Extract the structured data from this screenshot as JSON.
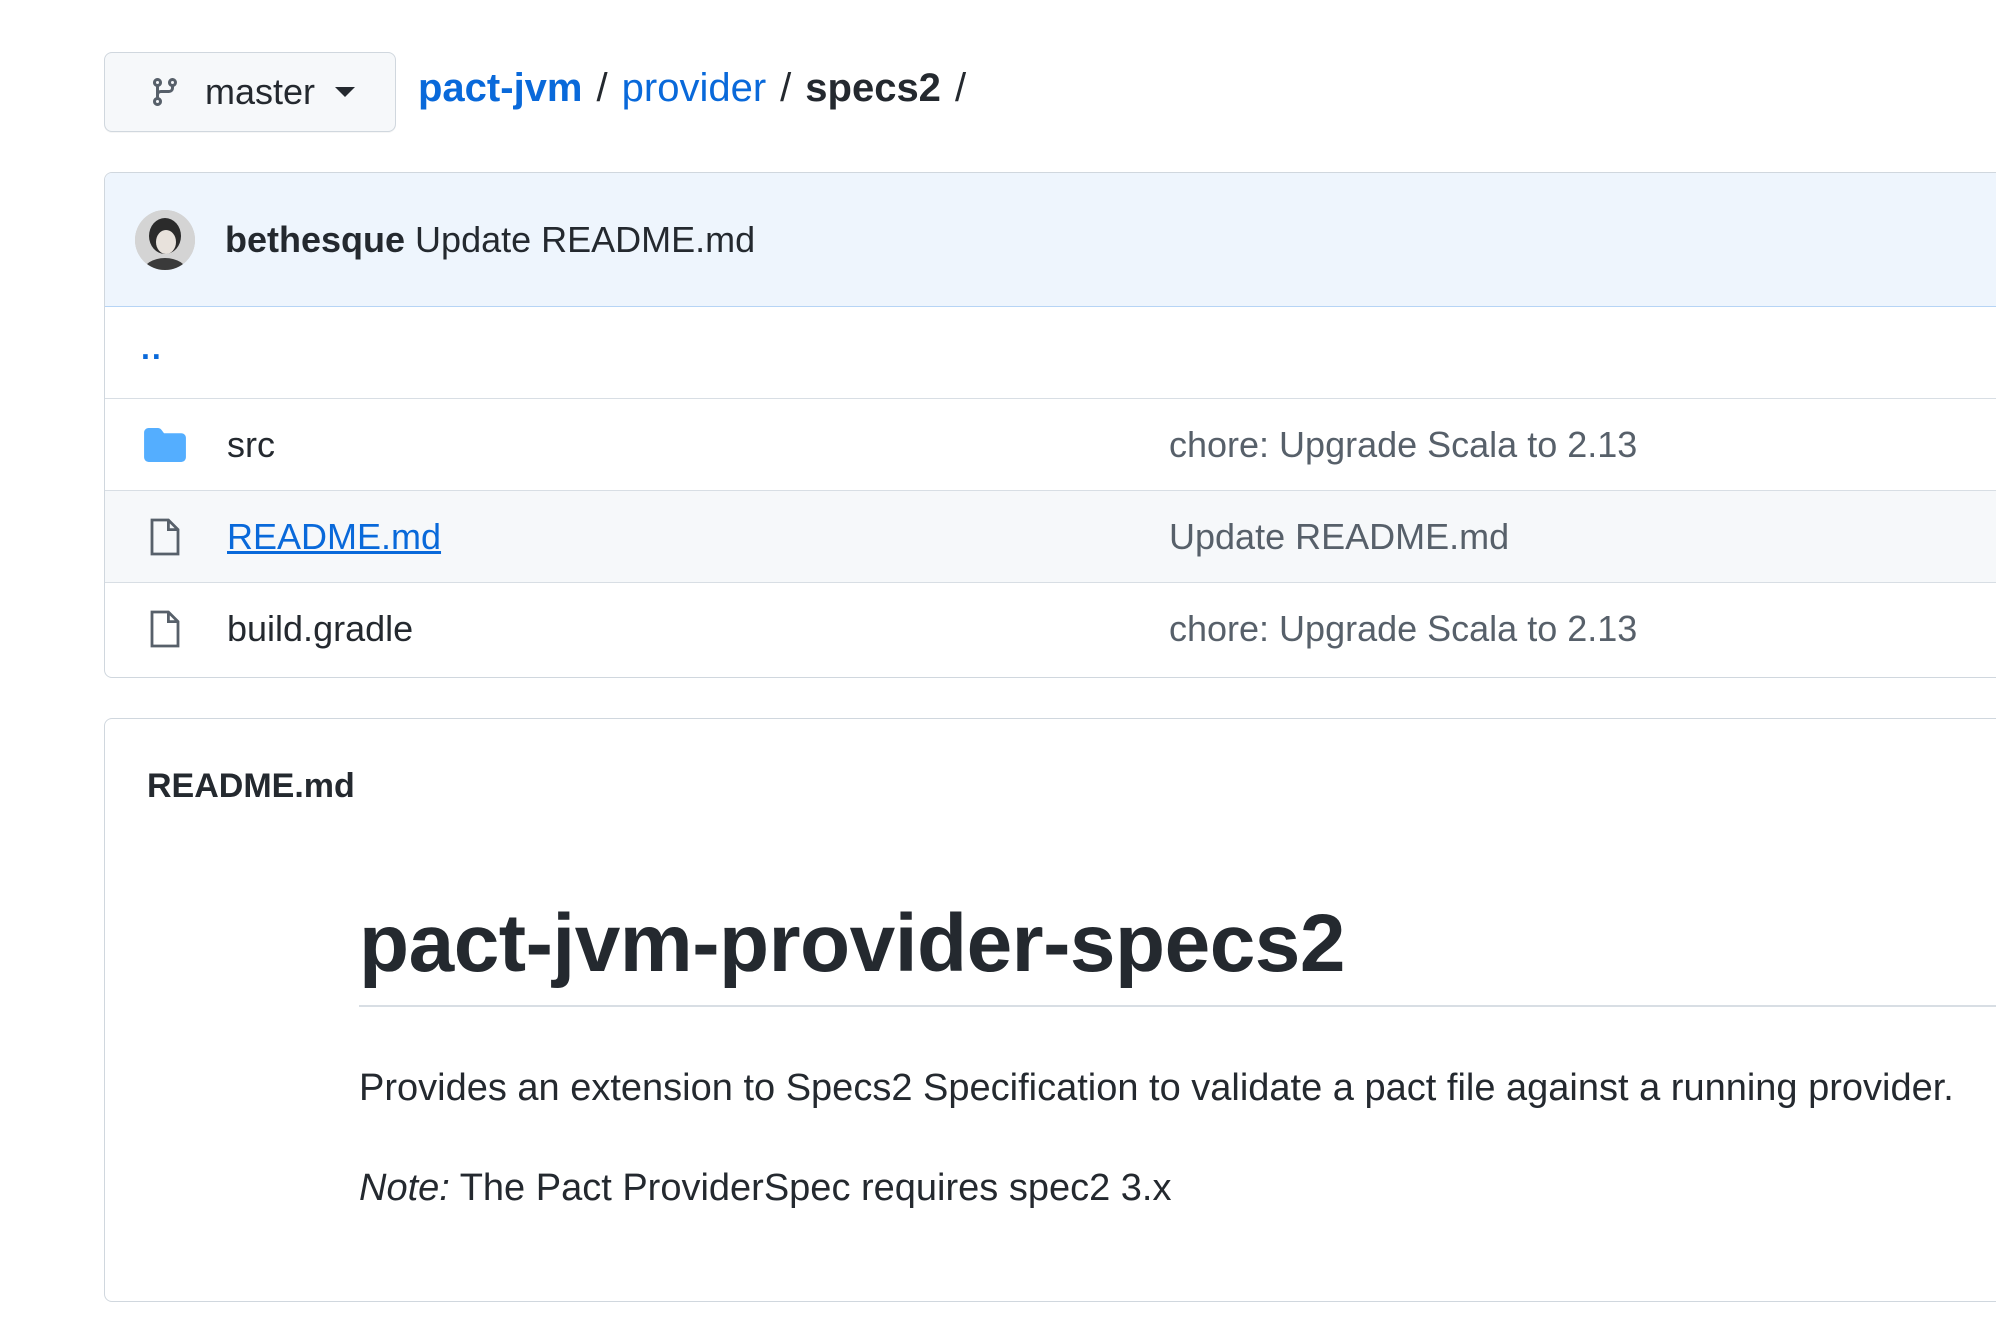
{
  "branch": {
    "name": "master"
  },
  "breadcrumb": {
    "repo": "pact-jvm",
    "folder": "provider",
    "current": "specs2",
    "separator": "/"
  },
  "latest_commit": {
    "author": "bethesque",
    "message": "Update README.md"
  },
  "files": {
    "up_label": "..",
    "items": [
      {
        "name": "src",
        "type": "folder",
        "commit_message": "chore: Upgrade Scala to 2.13"
      },
      {
        "name": "README.md",
        "type": "file",
        "commit_message": "Update README.md"
      },
      {
        "name": "build.gradle",
        "type": "file",
        "commit_message": "chore: Upgrade Scala to 2.13"
      }
    ]
  },
  "readme": {
    "filename": "README.md",
    "heading": "pact-jvm-provider-specs2",
    "paragraph": "Provides an extension to Specs2 Specification to validate a pact file against a running provider.",
    "note_label": "Note:",
    "note_text": " The Pact ProviderSpec requires spec2 3.x"
  },
  "colors": {
    "link": "#0969da",
    "commit_bar": "#eef5fd",
    "folder_icon": "#54aeff"
  },
  "icons": {
    "branch": "git-branch-icon",
    "folder": "folder-icon",
    "file": "file-icon",
    "caret": "caret-down-icon"
  }
}
